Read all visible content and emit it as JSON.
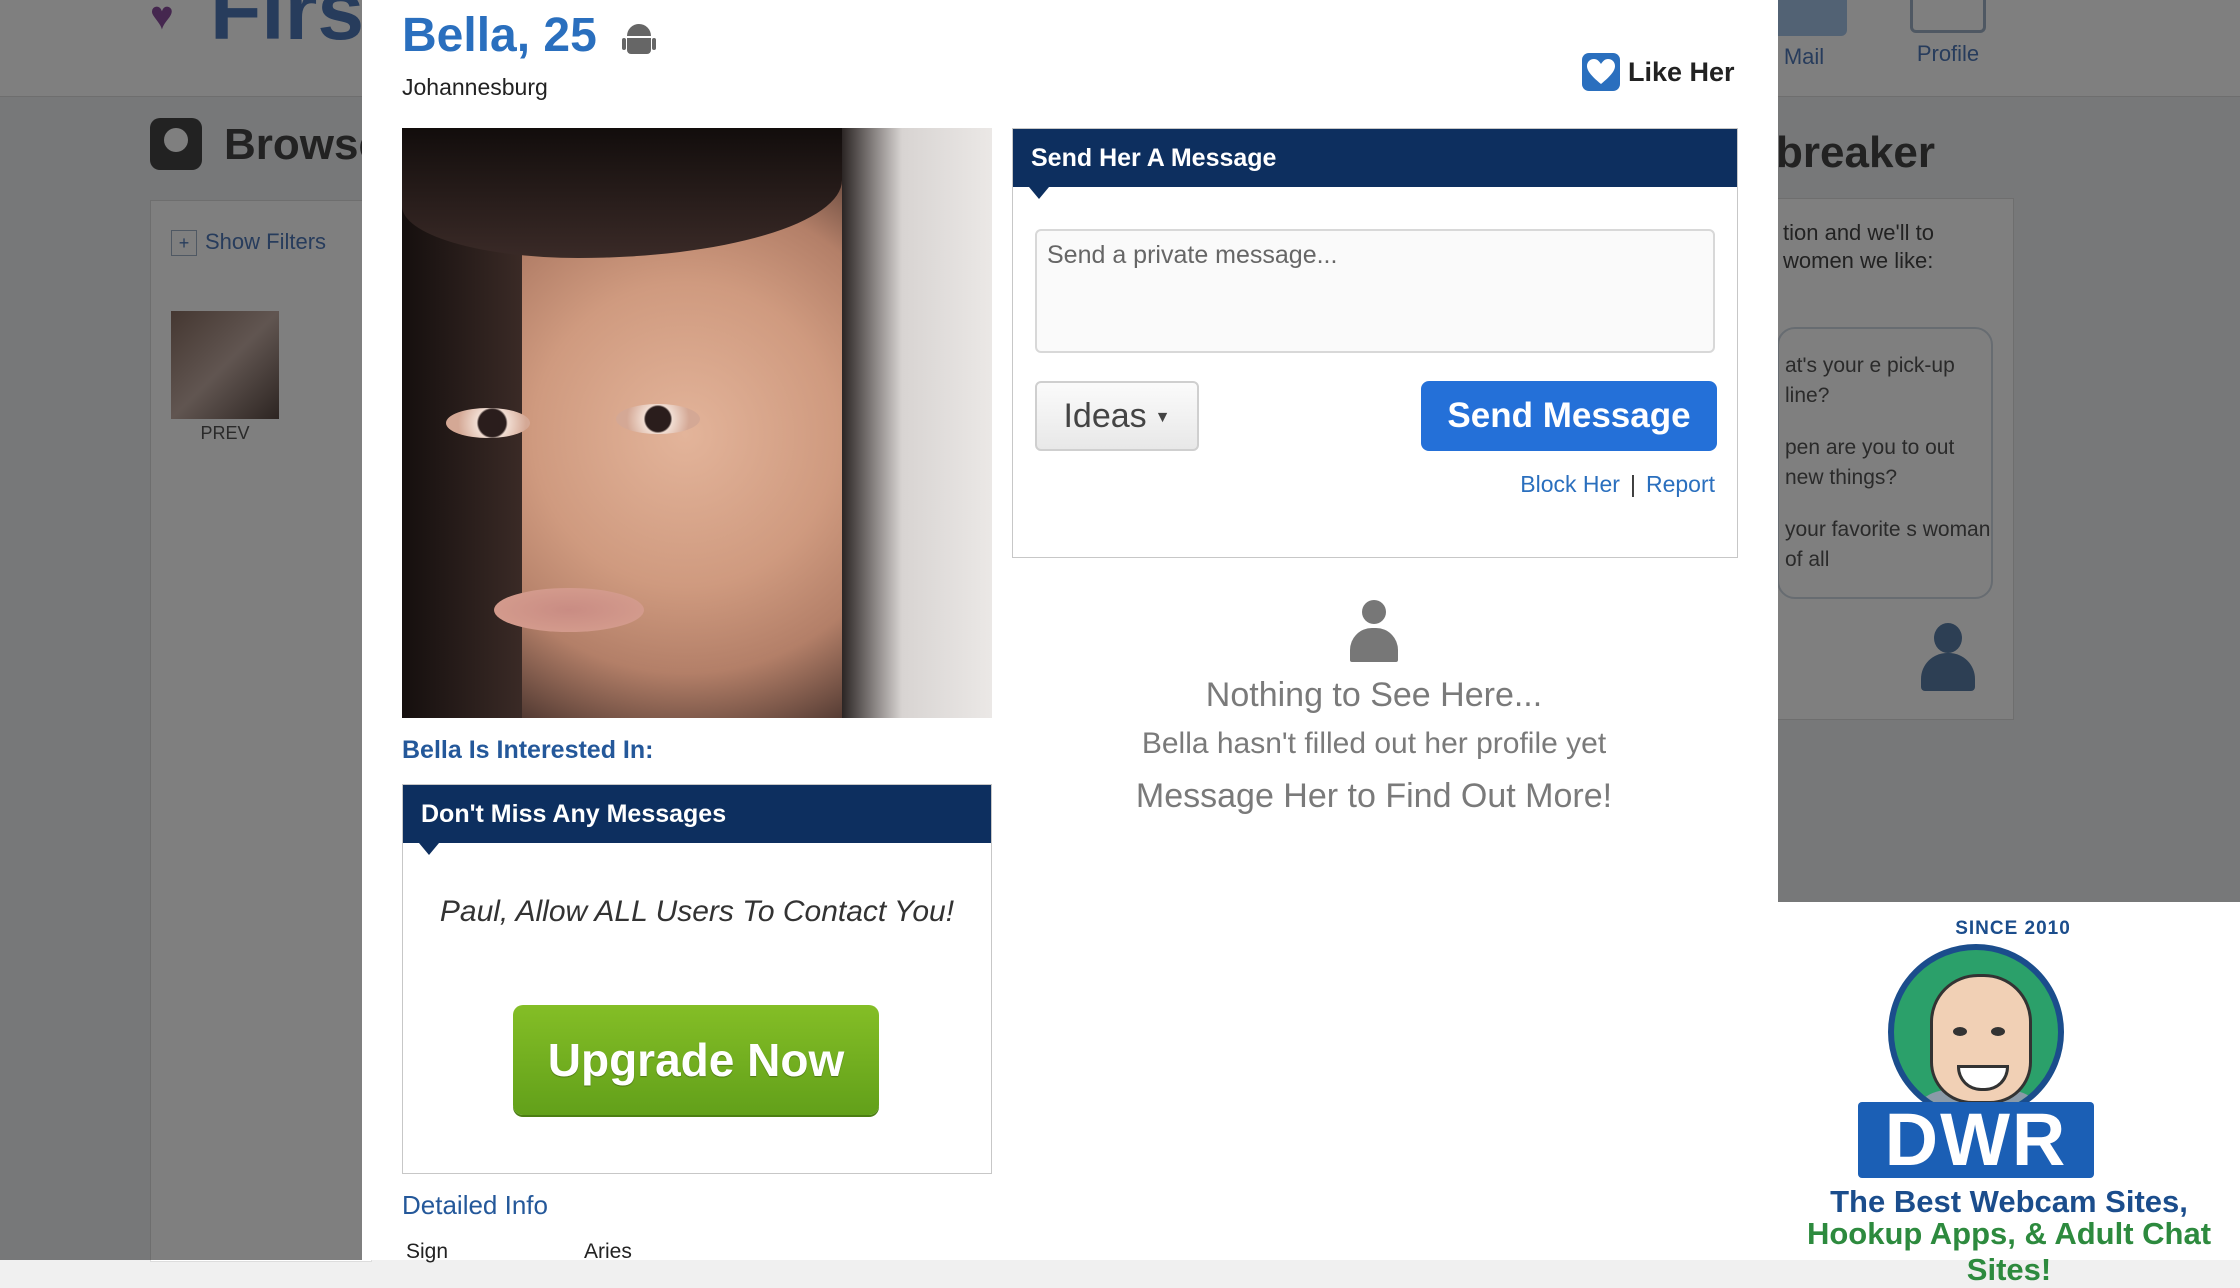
{
  "background": {
    "logo_text": "First",
    "nav": [
      {
        "label": "Mail"
      },
      {
        "label": "Profile"
      }
    ],
    "browse_title": "Browse",
    "show_filters": "Show Filters",
    "prev_label": "PREV",
    "icebreaker_title": "breaker",
    "icebreaker_intro": "tion and we'll to women we like:",
    "icebreaker_questions": [
      "at's your e pick-up line?",
      "pen are you to out new things?",
      "your favorite s woman of all"
    ]
  },
  "profile": {
    "name_age": "Bella, 25",
    "device_icon": "android-icon",
    "location": "Johannesburg",
    "like_label": "Like Her",
    "interested_in": "Bella Is Interested In:"
  },
  "upgrade": {
    "header": "Don't Miss Any Messages",
    "text": "Paul, Allow ALL Users To Contact You!",
    "button": "Upgrade Now"
  },
  "details": {
    "title": "Detailed Info",
    "rows": [
      {
        "label": "Sign",
        "value": "Aries"
      }
    ]
  },
  "message": {
    "header": "Send Her A Message",
    "placeholder": "Send a private message...",
    "ideas_label": "Ideas",
    "send_label": "Send Message",
    "block_label": "Block Her",
    "separator": "|",
    "report_label": "Report"
  },
  "empty_state": {
    "icon": "person-icon",
    "title": "Nothing to See Here...",
    "subtitle": "Bella hasn't filled out her profile yet",
    "cta": "Message Her to Find Out More!"
  },
  "badge": {
    "since": "SINCE 2010",
    "letters": "DWR",
    "line1": "The Best Webcam Sites,",
    "line2": "Hookup Apps, & Adult Chat Sites!"
  },
  "colors": {
    "accent_blue": "#2a6fbe",
    "header_navy": "#0d2f5f",
    "upgrade_green": "#6aa81e",
    "send_blue": "#2470d8"
  }
}
